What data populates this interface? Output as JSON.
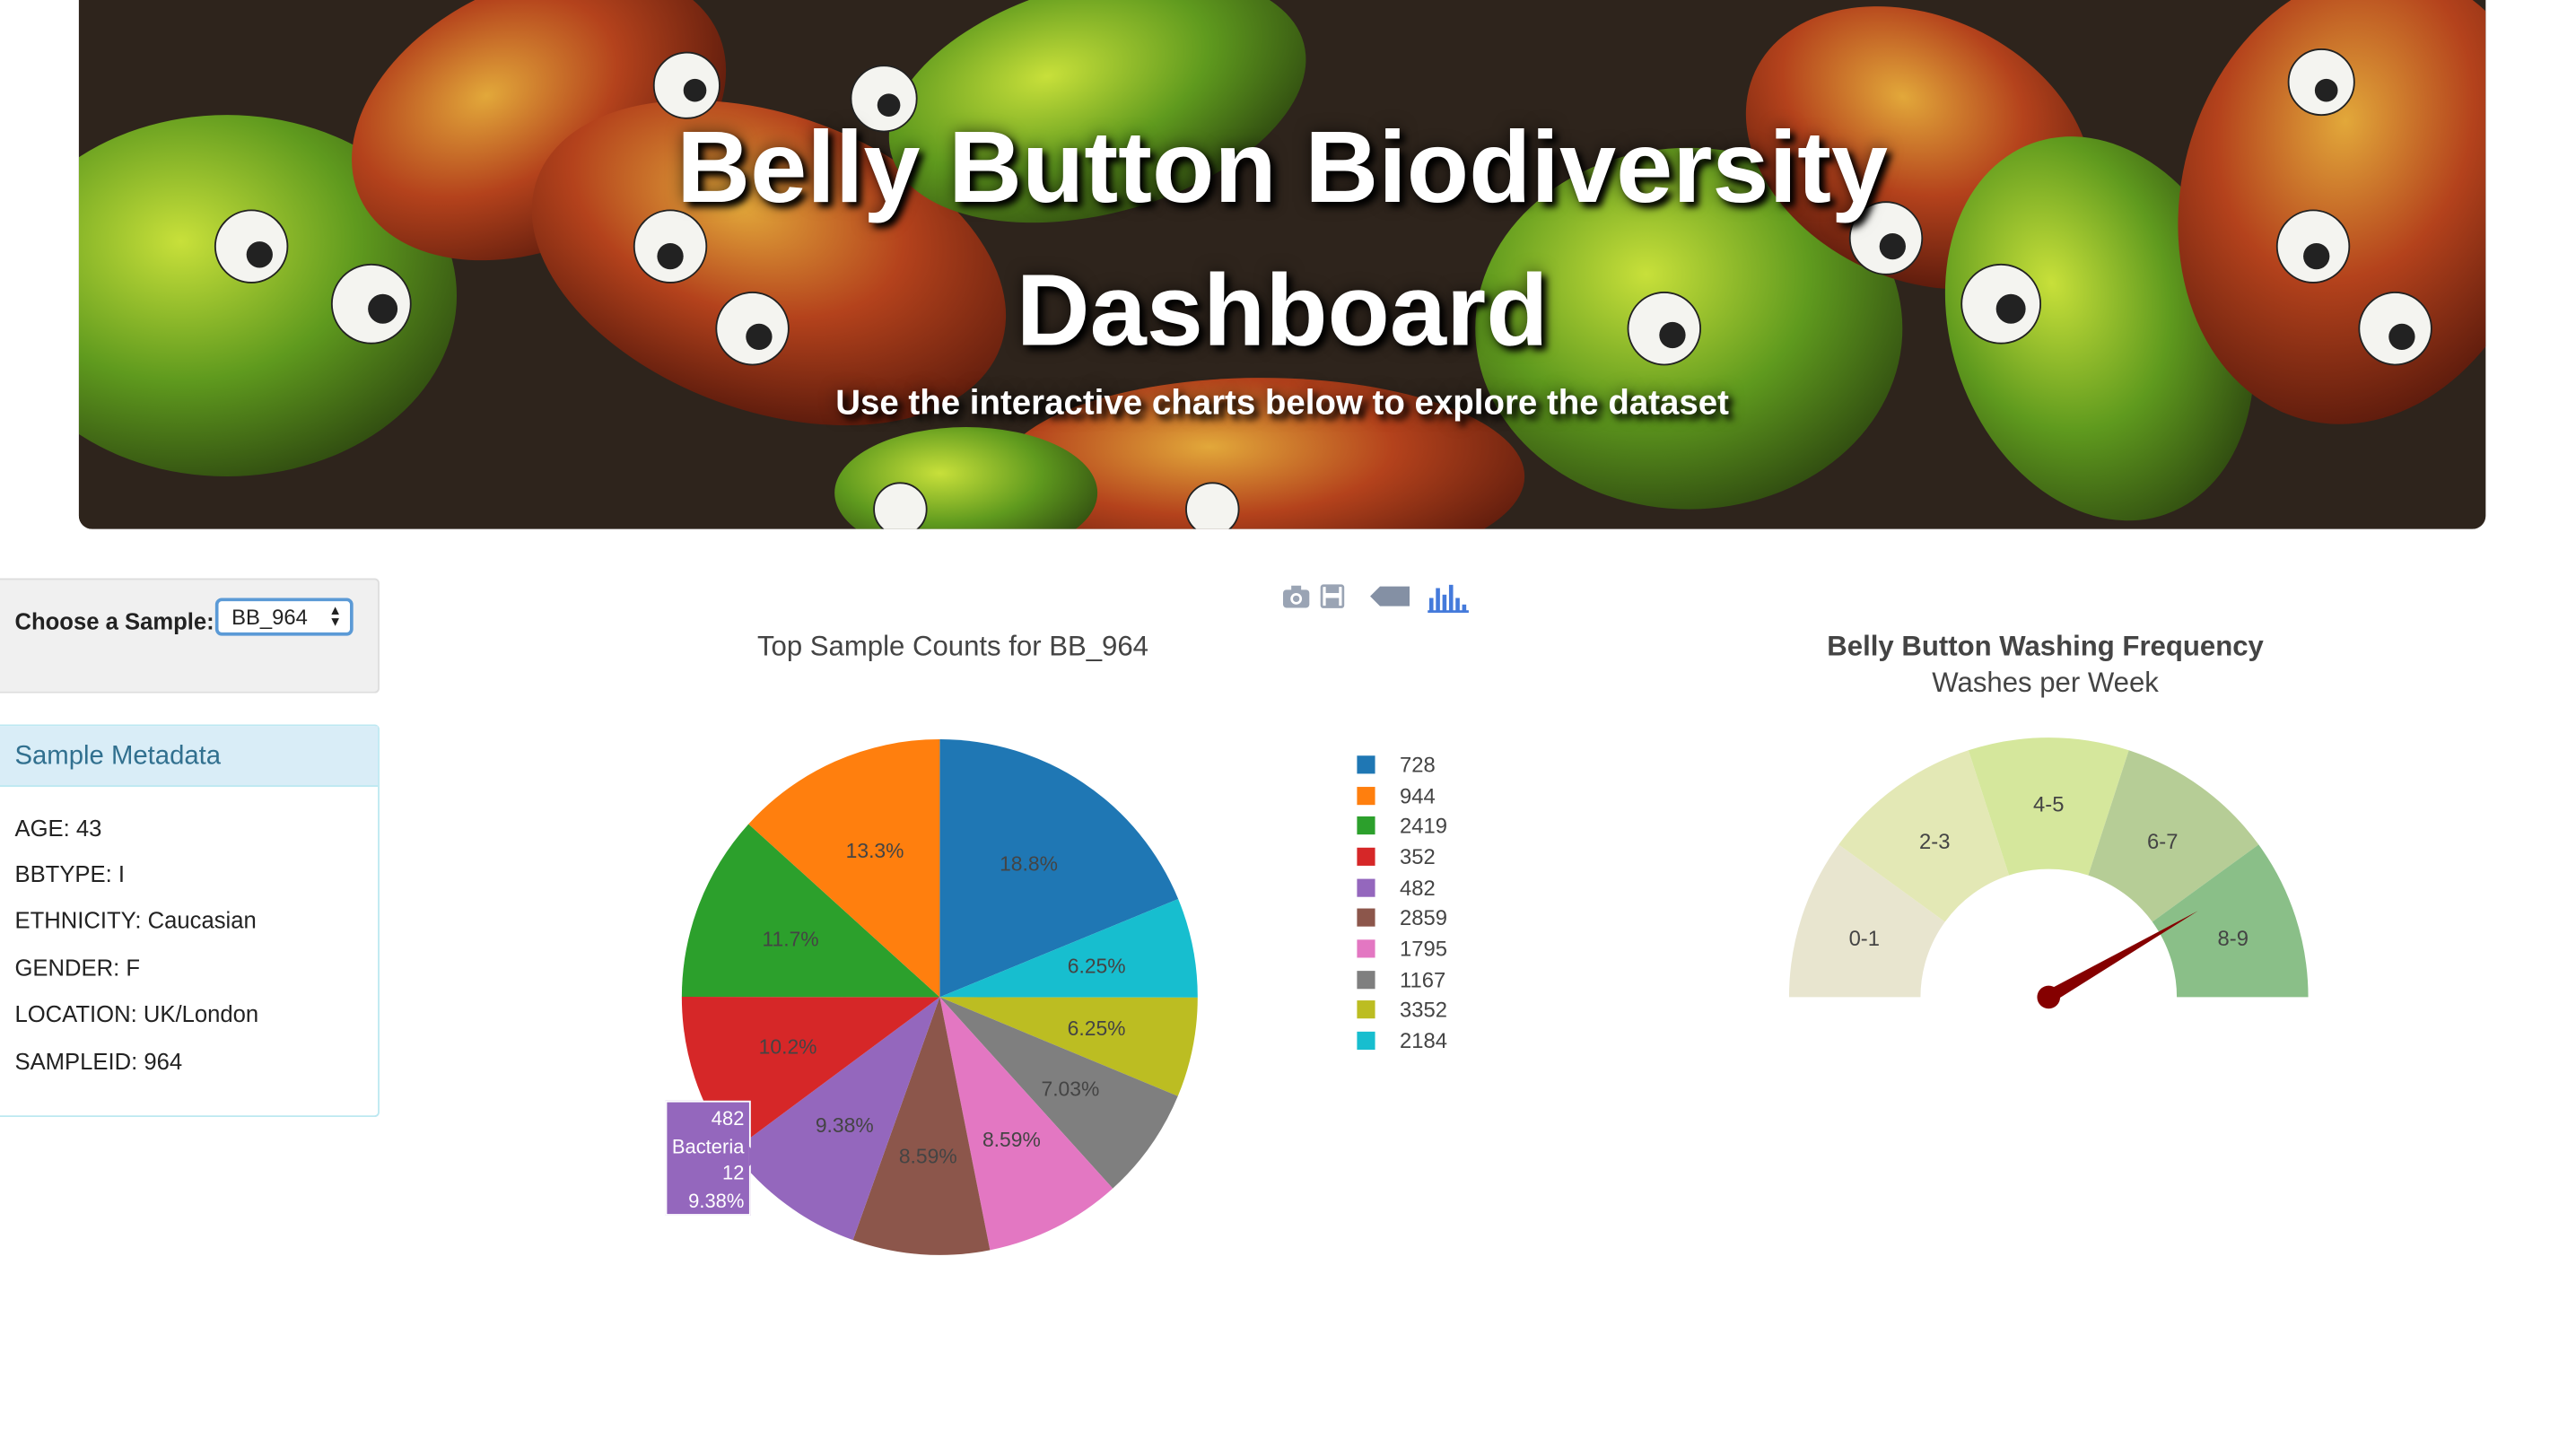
{
  "banner": {
    "title_line1": "Belly Button Biodiversity",
    "title_line2": "Dashboard",
    "subtitle": "Use the interactive charts below to explore the dataset"
  },
  "selector": {
    "label": "Choose a Sample:",
    "selected": "BB_964"
  },
  "metadata": {
    "heading": "Sample Metadata",
    "rows": [
      "AGE: 43",
      "BBTYPE: I",
      "ETHNICITY: Caucasian",
      "GENDER: F",
      "LOCATION: UK/London",
      "SAMPLEID: 964"
    ]
  },
  "modebar": {
    "icons": [
      "camera-icon",
      "save-icon",
      "tag-icon",
      "plotly-logo-icon"
    ]
  },
  "colors": {
    "series": [
      "#1f77b4",
      "#ff7f0e",
      "#2ca02c",
      "#d62728",
      "#9467bd",
      "#8c564b",
      "#e377c2",
      "#7f7f7f",
      "#bcbd22",
      "#17becf"
    ],
    "panel_heading_bg": "#d9edf7",
    "panel_heading_text": "#31708f",
    "needle": "#850000"
  },
  "hover": {
    "lines": [
      "482",
      "Bacteria",
      "12",
      "9.38%"
    ]
  },
  "chart_data": [
    {
      "type": "pie",
      "title": "Top Sample Counts for BB_964",
      "labels": [
        "728",
        "944",
        "2419",
        "352",
        "482",
        "2859",
        "1795",
        "1167",
        "3352",
        "2184"
      ],
      "values": [
        18.8,
        13.3,
        11.7,
        10.2,
        9.38,
        8.59,
        8.59,
        7.03,
        6.25,
        6.25
      ],
      "slice_labels": [
        "18.8%",
        "13.3%",
        "11.7%",
        "10.2%",
        "9.38%",
        "8.59%",
        "8.59%",
        "7.03%",
        "6.25%",
        "6.25%"
      ],
      "legend_placement": "right",
      "direction": "clockwise",
      "sort_order": "descending"
    },
    {
      "type": "gauge",
      "title": "Belly Button Washing Frequency",
      "subtitle": "Washes per Week",
      "bands": [
        "0-1",
        "2-3",
        "4-5",
        "6-7",
        "8-9"
      ],
      "band_colors": [
        "#e8e5cf",
        "#e3e8b5",
        "#d5e79c",
        "#b6cd96",
        "#8abf88"
      ],
      "range": [
        0,
        9
      ],
      "value": 7.5
    }
  ]
}
